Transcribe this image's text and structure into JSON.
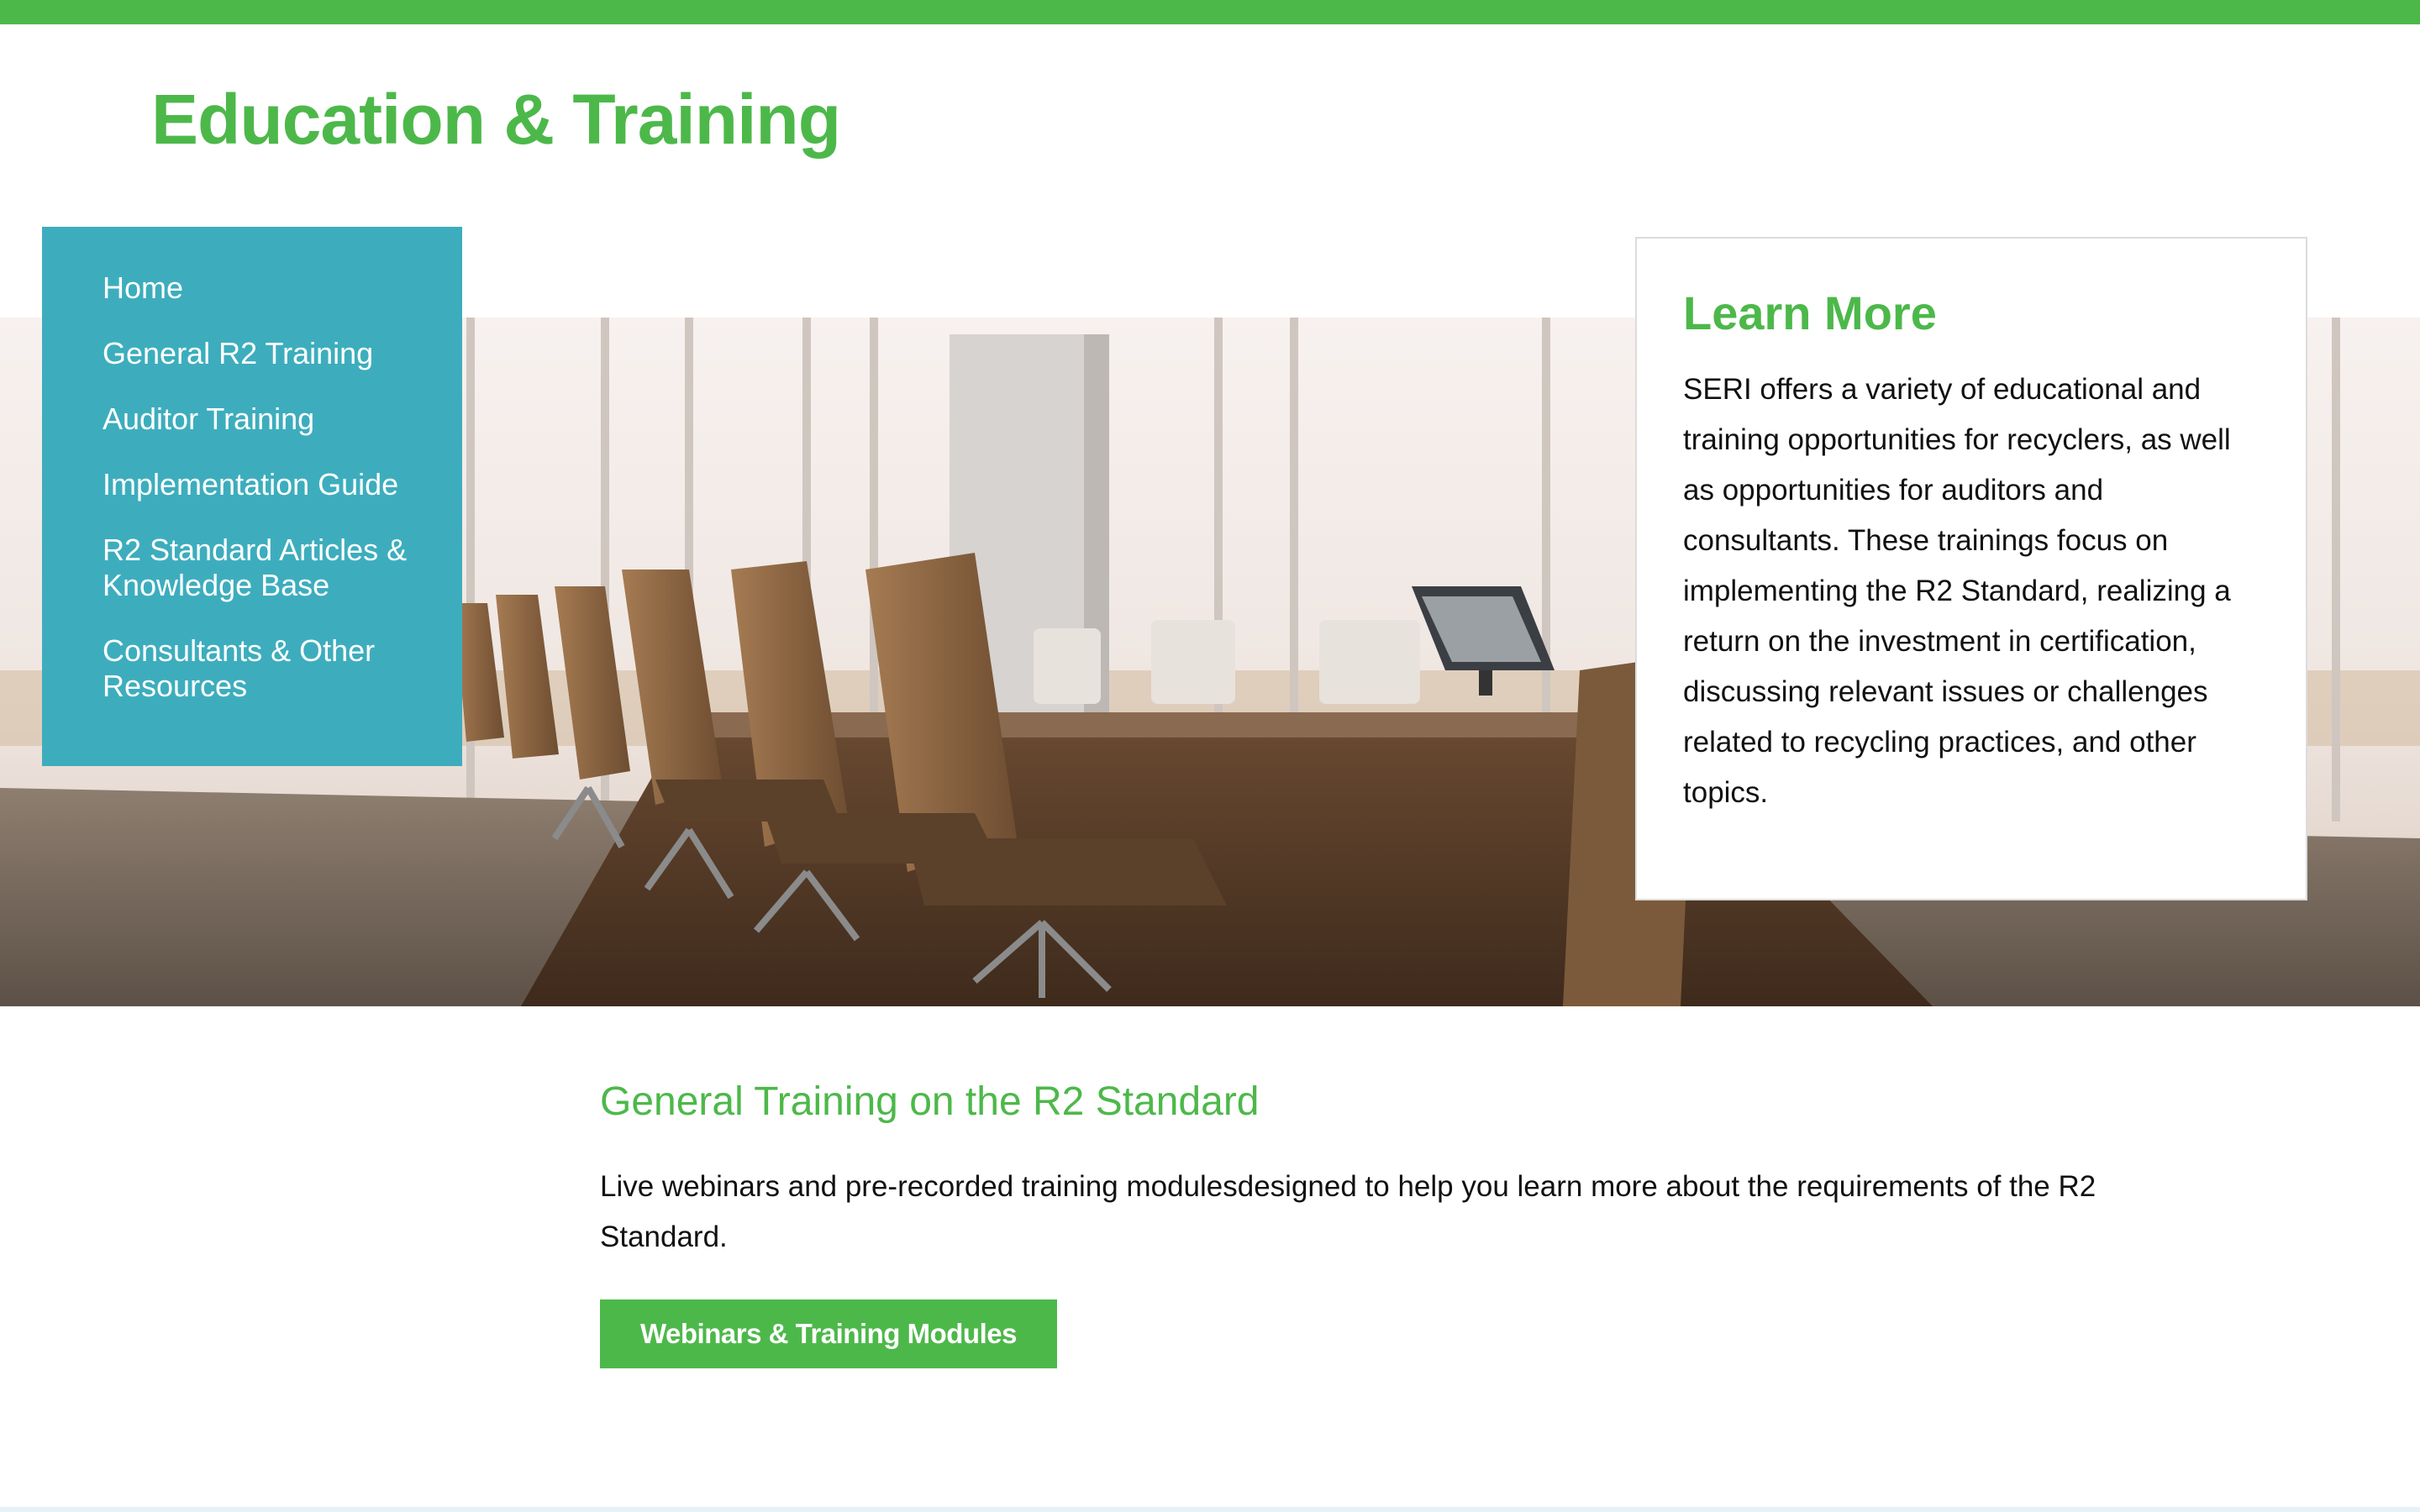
{
  "header": {
    "title": "Education & Training"
  },
  "sidebar": {
    "items": [
      {
        "label": "Home"
      },
      {
        "label": "General R2 Training"
      },
      {
        "label": "Auditor Training"
      },
      {
        "label": "Implementation Guide"
      },
      {
        "label": "R2 Standard Articles & Knowledge Base"
      },
      {
        "label": "Consultants & Other Resources"
      }
    ]
  },
  "learn_more": {
    "title": "Learn More",
    "body": "SERI offers a variety of educational and training opportunities for recyclers, as well as opportunities for auditors and consultants. These trainings focus on implementing the R2 Standard, realizing a return on the investment in certification, discussing relevant issues or challenges related to recycling practices, and other topics."
  },
  "general_training": {
    "title": "General Training on the R2 Standard",
    "body": "Live webinars and pre-recorded training modulesdesigned to help you learn more about the requirements of the R2 Standard.",
    "button_label": "Webinars & Training Modules"
  },
  "colors": {
    "accent_green": "#4db84a",
    "nav_teal": "#3dadbd"
  }
}
